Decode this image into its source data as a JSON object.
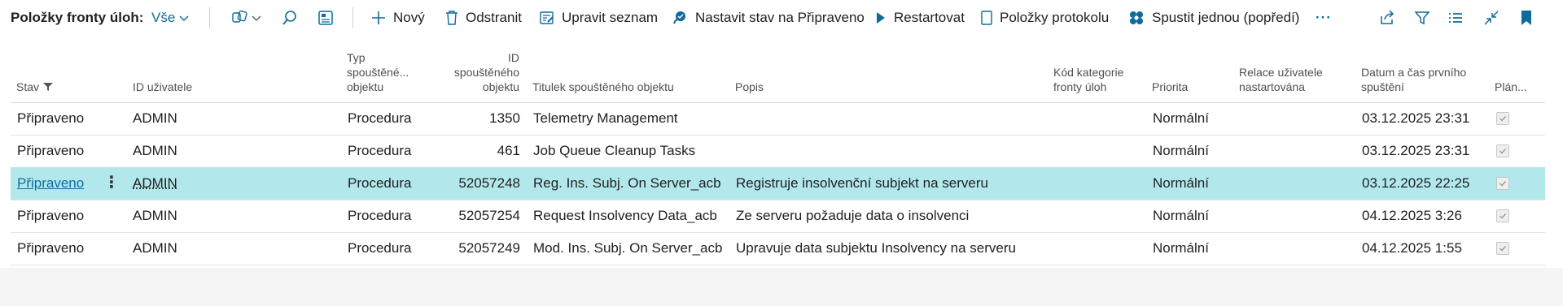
{
  "toolbar": {
    "title": "Položky fronty úloh:",
    "view": "Vše",
    "new_label": "Nový",
    "delete_label": "Odstranit",
    "edit_list_label": "Upravit seznam",
    "set_ready_label": "Nastavit stav na Připraveno",
    "restart_label": "Restartovat",
    "log_entries_label": "Položky protokolu",
    "run_once_label": "Spustit jednou (popředí)",
    "more_label": "···"
  },
  "columns": {
    "status": "Stav",
    "user_id": "ID uživatele",
    "object_type": [
      "Typ",
      "spouštěné...",
      "objektu"
    ],
    "object_id": [
      "ID",
      "spouštěného",
      "objektu"
    ],
    "object_caption": "Titulek spouštěného objektu",
    "description": "Popis",
    "category": [
      "Kód kategorie",
      "fronty úloh"
    ],
    "priority": "Priorita",
    "user_session": [
      "Relace uživatele",
      "nastartována"
    ],
    "earliest_start": [
      "Datum a čas prvního",
      "spuštění"
    ],
    "scheduled": "Plán..."
  },
  "rows": [
    {
      "status": "Připraveno",
      "user_id": "ADMIN",
      "object_type": "Procedura",
      "object_id": "1350",
      "caption": "Telemetry Management",
      "description": "",
      "category": "",
      "priority": "Normální",
      "session": "",
      "start": "03.12.2025 23:31",
      "scheduled": true
    },
    {
      "status": "Připraveno",
      "user_id": "ADMIN",
      "object_type": "Procedura",
      "object_id": "461",
      "caption": "Job Queue Cleanup Tasks",
      "description": "",
      "category": "",
      "priority": "Normální",
      "session": "",
      "start": "03.12.2025 23:31",
      "scheduled": true
    },
    {
      "status": "Připraveno",
      "user_id": "ADMIN",
      "object_type": "Procedura",
      "object_id": "52057248",
      "caption": "Reg. Ins. Subj. On Server_acb",
      "description": "Registruje insolvenční subjekt na serveru",
      "category": "",
      "priority": "Normální",
      "session": "",
      "start": "03.12.2025 22:25",
      "scheduled": true,
      "selected": true
    },
    {
      "status": "Připraveno",
      "user_id": "ADMIN",
      "object_type": "Procedura",
      "object_id": "52057254",
      "caption": "Request Insolvency Data_acb",
      "description": "Ze serveru požaduje data o insolvenci",
      "category": "",
      "priority": "Normální",
      "session": "",
      "start": "04.12.2025 3:26",
      "scheduled": true
    },
    {
      "status": "Připraveno",
      "user_id": "ADMIN",
      "object_type": "Procedura",
      "object_id": "52057249",
      "caption": "Mod. Ins. Subj. On Server_acb",
      "description": "Upravuje data subjektu Insolvency na serveru",
      "category": "",
      "priority": "Normální",
      "session": "",
      "start": "04.12.2025 1:55",
      "scheduled": true
    }
  ],
  "colors": {
    "accent": "#0f6b9a",
    "selected_row": "#b2e8ec"
  }
}
